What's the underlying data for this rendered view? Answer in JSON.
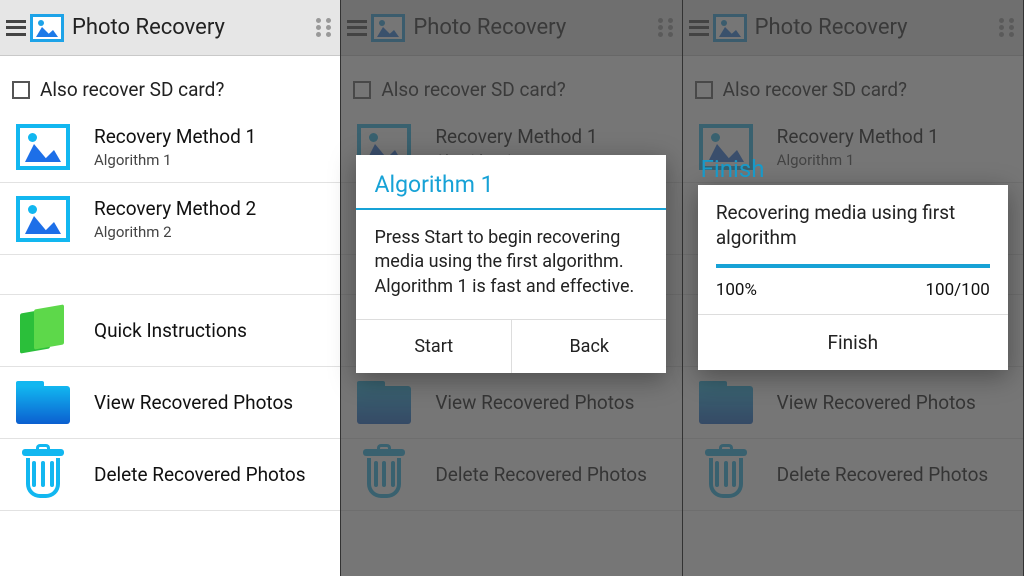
{
  "app": {
    "title": "Photo Recovery"
  },
  "sd": {
    "label": "Also recover SD card?"
  },
  "methods": [
    {
      "title": "Recovery Method 1",
      "sub": "Algorithm 1"
    },
    {
      "title": "Recovery Method 2",
      "sub": "Algorithm 2"
    }
  ],
  "actions": {
    "quick": "Quick Instructions",
    "view": "View Recovered Photos",
    "delete": "Delete Recovered Photos"
  },
  "dialog1": {
    "title": "Algorithm 1",
    "body": "Press Start to begin recovering media using the first algorithm. Algorithm 1 is fast and effective.",
    "start": "Start",
    "back": "Back"
  },
  "dialog2": {
    "finish_label": "Finish",
    "body": "Recovering media using first algorithm",
    "percent": "100%",
    "count": "100/100",
    "action": "Finish"
  }
}
